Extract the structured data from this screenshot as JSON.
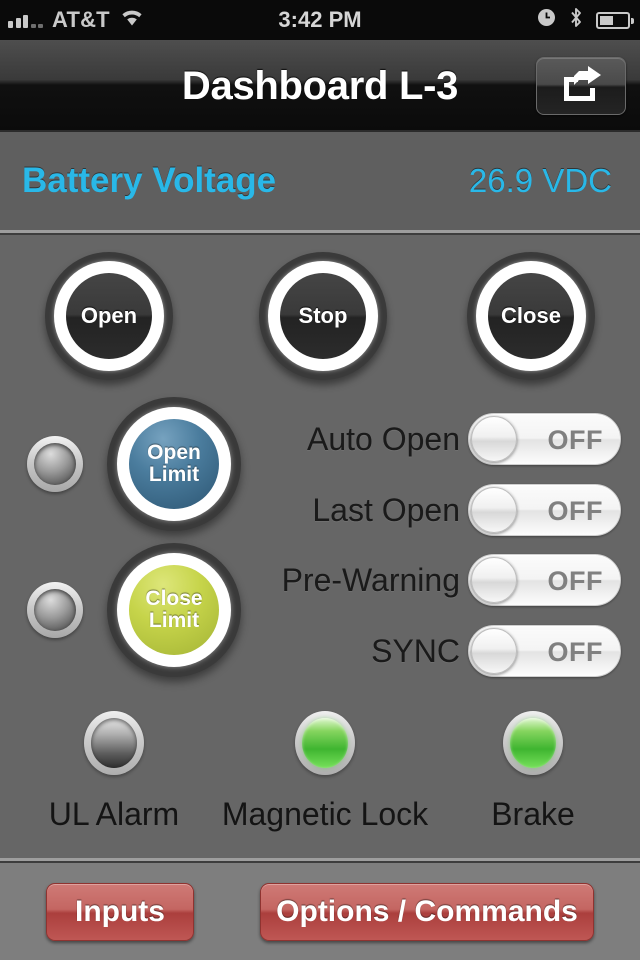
{
  "status_bar": {
    "carrier": "AT&T",
    "signal_icon": "signal-bars-icon",
    "wifi_icon": "wifi-icon",
    "time": "3:42 PM",
    "alarm_icon": "alarm-clock-icon",
    "bluetooth_icon": "bluetooth-icon",
    "battery_icon": "battery-icon"
  },
  "title_bar": {
    "title": "Dashboard L-3",
    "share_icon": "share-icon"
  },
  "voltage": {
    "label": "Battery Voltage",
    "value": "26.9 VDC",
    "accent_color": "#29b8e8"
  },
  "command_buttons": [
    {
      "label": "Open",
      "name": "open-button"
    },
    {
      "label": "Stop",
      "name": "stop-button"
    },
    {
      "label": "Close",
      "name": "close-button"
    }
  ],
  "limit_buttons": [
    {
      "line1": "Open",
      "line2": "Limit",
      "color": "#4b7d9e",
      "indicator_state": "off"
    },
    {
      "line1": "Close",
      "line2": "Limit",
      "color": "#c6d44a",
      "indicator_state": "off"
    }
  ],
  "toggles": [
    {
      "label": "Auto Open",
      "state": "OFF"
    },
    {
      "label": "Last Open",
      "state": "OFF"
    },
    {
      "label": "Pre-Warning",
      "state": "OFF"
    },
    {
      "label": "SYNC",
      "state": "OFF"
    }
  ],
  "status_leds": [
    {
      "label": "UL Alarm",
      "state": "off",
      "color": "#4a4a4a"
    },
    {
      "label": "Magnetic Lock",
      "state": "on",
      "color": "#3fb530"
    },
    {
      "label": "Brake",
      "state": "on",
      "color": "#3fb530"
    }
  ],
  "footer": {
    "inputs_label": "Inputs",
    "options_label": "Options / Commands"
  }
}
